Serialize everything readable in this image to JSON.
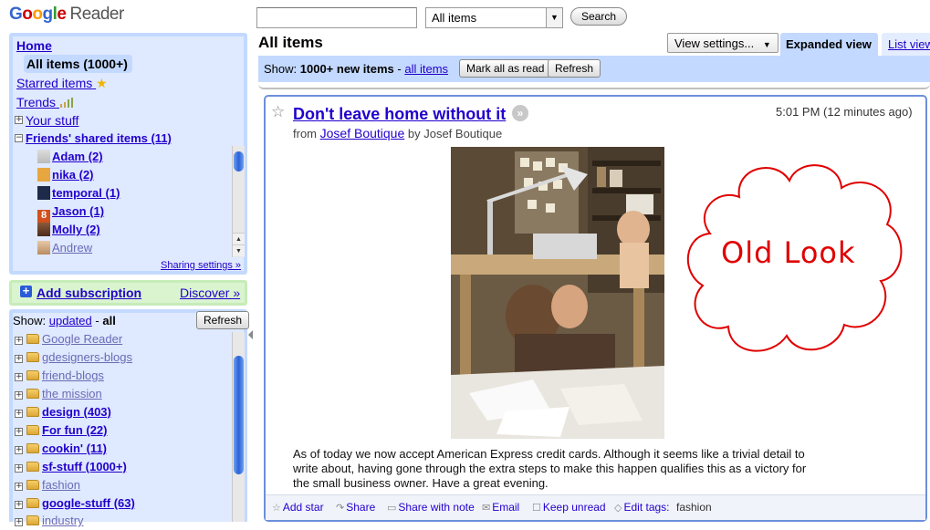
{
  "app": {
    "logo_google": "Google",
    "logo_reader": "Reader"
  },
  "search": {
    "value": "",
    "scope_selected": "All items",
    "button_label": "Search"
  },
  "nav": {
    "home": "Home",
    "all_items": "All items  (1000+)",
    "starred_items": "Starred items",
    "trends": "Trends",
    "your_stuff": "Your stuff",
    "friends_shared": "Friends' shared items (11)",
    "friends": [
      {
        "name": "Adam (2)",
        "unread": true
      },
      {
        "name": "nika (2)",
        "unread": true
      },
      {
        "name": "temporal (1)",
        "unread": true
      },
      {
        "name": "Jason (1)",
        "unread": true
      },
      {
        "name": "Molly (2)",
        "unread": true
      },
      {
        "name": "Andrew",
        "unread": false
      }
    ],
    "sharing_settings": "Sharing settings »"
  },
  "add_subscription": {
    "label": "Add subscription",
    "discover": "Discover »"
  },
  "subscriptions": {
    "show_label": "Show:",
    "show_updated": "updated",
    "show_separator": "-",
    "show_all": "all",
    "refresh_label": "Refresh",
    "folders": [
      {
        "name": "Google Reader",
        "bold": false
      },
      {
        "name": "gdesigners-blogs",
        "bold": false
      },
      {
        "name": "friend-blogs",
        "bold": false
      },
      {
        "name": "the mission",
        "bold": false
      },
      {
        "name": "design (403)",
        "bold": true
      },
      {
        "name": "For fun (22)",
        "bold": true
      },
      {
        "name": "cookin' (11)",
        "bold": true
      },
      {
        "name": "sf-stuff (1000+)",
        "bold": true
      },
      {
        "name": "fashion",
        "bold": false
      },
      {
        "name": "google-stuff (63)",
        "bold": true
      },
      {
        "name": "industry",
        "bold": false
      }
    ]
  },
  "main": {
    "title": "All items",
    "view_settings": "View settings...",
    "tab_expanded": "Expanded view",
    "tab_list": "List view",
    "toolbar_show": "Show:",
    "toolbar_new_items": "1000+ new items",
    "toolbar_dash": "-",
    "toolbar_all_items": "all items",
    "mark_all_read": "Mark all as read",
    "refresh": "Refresh"
  },
  "entry": {
    "title": "Don't leave home without it",
    "time": "5:01 PM (12 minutes ago)",
    "from_prefix": "from",
    "source": "Josef Boutique",
    "by_line": "by Josef Boutique",
    "body": "As of today we now accept American Express credit cards. Although it seems like a trivial detail to write about, having gone through the extra steps to make this happen qualifies this as a victory for the small business owner. Have a great evening.",
    "actions": {
      "add_star": "Add star",
      "share": "Share",
      "share_with_note": "Share with note",
      "email": "Email",
      "keep_unread": "Keep unread",
      "edit_tags": "Edit tags:",
      "tags": "fashion"
    }
  },
  "annotation": {
    "cloud_text": "Old Look",
    "color": "#e00000"
  },
  "colors": {
    "nav_blue": "#c3d9ff",
    "nav_inner": "#dfe9ff",
    "add_green": "#c6ecb8",
    "link": "#2200cc",
    "entry_border": "#6b90da"
  }
}
